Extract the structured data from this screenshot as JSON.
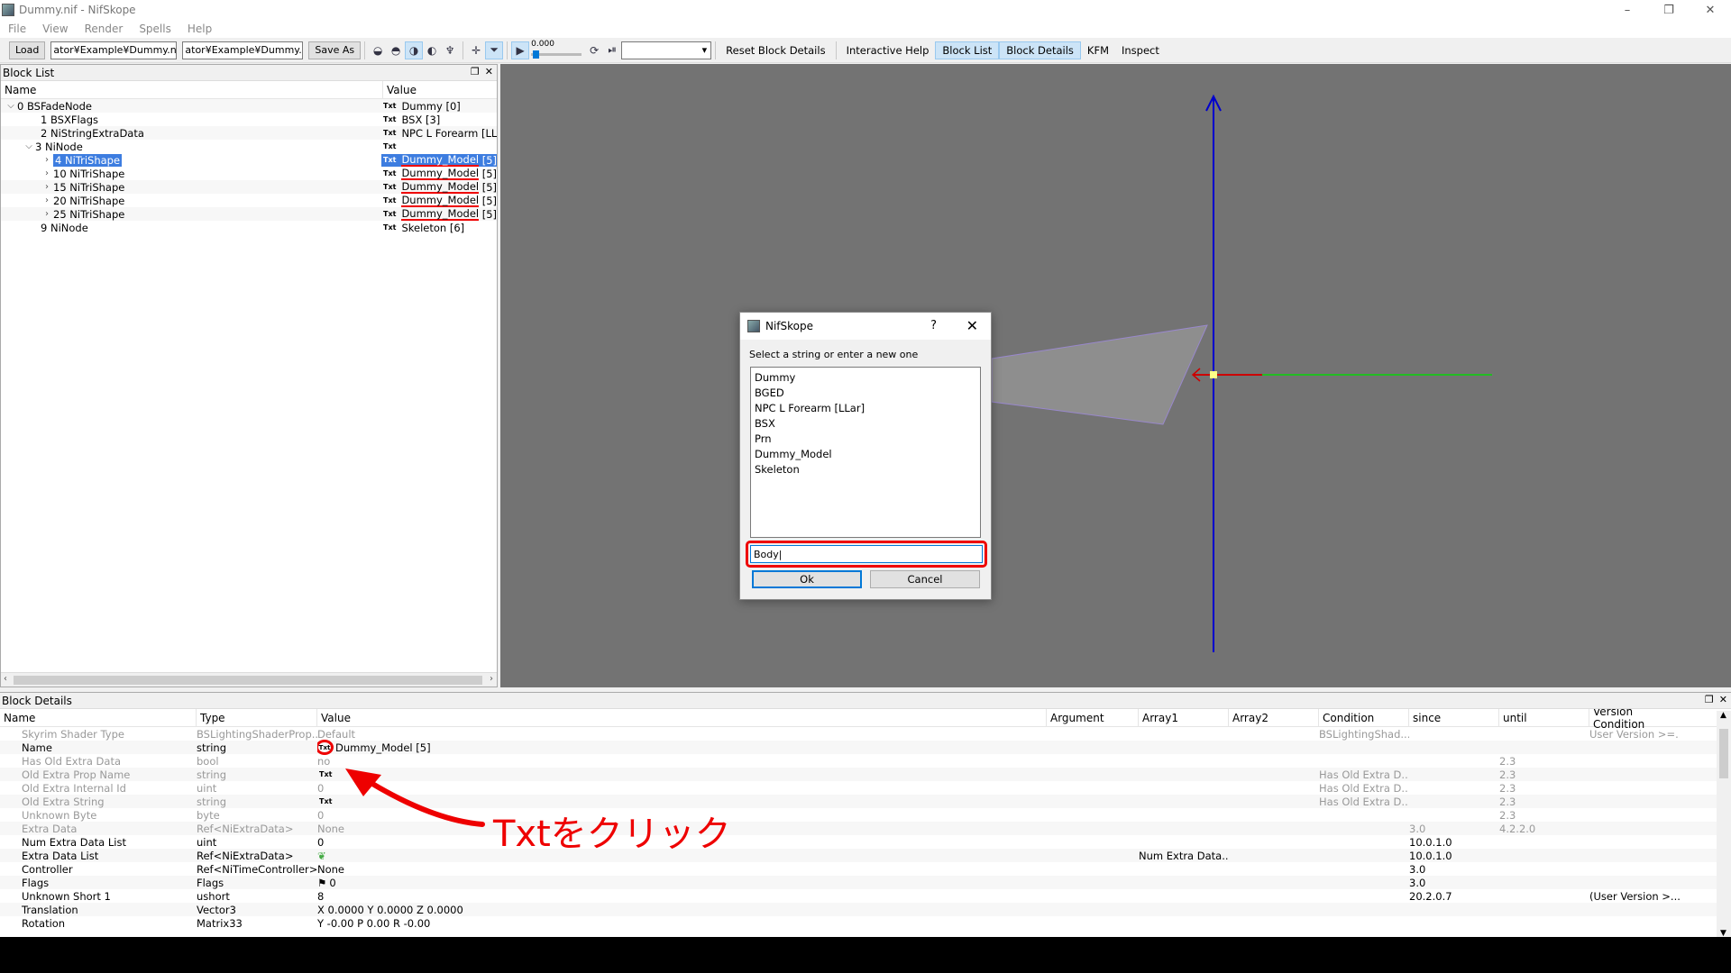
{
  "window": {
    "title": "Dummy.nif - NifSkope",
    "controls": [
      "–",
      "❐",
      "✕"
    ]
  },
  "menu": [
    "File",
    "View",
    "Render",
    "Spells",
    "Help"
  ],
  "toolbar": {
    "load_label": "Load",
    "path1": "ator¥Example¥Dummy.nif",
    "path2": "ator¥Example¥Dummy.nif",
    "save_as_label": "Save As",
    "time_value": "0.000",
    "reset_block_details": "Reset Block Details",
    "interactive_help": "Interactive Help",
    "block_list": "Block List",
    "block_details": "Block Details",
    "kfm": "KFM",
    "inspect": "Inspect"
  },
  "block_list": {
    "panel_title": "Block List",
    "col_name": "Name",
    "col_value": "Value",
    "txt_badge": "Txt",
    "rows": [
      {
        "name": "0 BSFadeNode",
        "value": "Dummy [0]"
      },
      {
        "name": "1 BSXFlags",
        "value": "BSX [3]"
      },
      {
        "name": "2 NiStringExtraData",
        "value": "NPC L Forearm [LLar"
      },
      {
        "name": "3 NiNode",
        "value": ""
      },
      {
        "name": "4 NiTriShape",
        "value_a": "Dummy_Model",
        "value_b": "[5]"
      },
      {
        "name": "10 NiTriShape",
        "value_a": "Dummy_Model",
        "value_b": "[5]"
      },
      {
        "name": "15 NiTriShape",
        "value_a": "Dummy_Model",
        "value_b": "[5]"
      },
      {
        "name": "20 NiTriShape",
        "value_a": "Dummy_Model",
        "value_b": "[5]"
      },
      {
        "name": "25 NiTriShape",
        "value_a": "Dummy_Model",
        "value_b": "[5]"
      },
      {
        "name": "9 NiNode",
        "value": "Skeleton [6]"
      }
    ]
  },
  "dialog": {
    "title": "NifSkope",
    "help": "?",
    "close": "✕",
    "prompt": "Select a string or enter a new one",
    "items": [
      "Dummy",
      "BGED",
      "NPC L Forearm [LLar]",
      "BSX",
      "Prn",
      "Dummy_Model",
      "Skeleton"
    ],
    "input_value": "Body|",
    "ok_label": "Ok",
    "cancel_label": "Cancel"
  },
  "block_details": {
    "panel_title": "Block Details",
    "columns": [
      "Name",
      "Type",
      "Value",
      "Argument",
      "Array1",
      "Array2",
      "Condition",
      "since",
      "until",
      "Version Condition"
    ],
    "rows": [
      {
        "name": "Skyrim Shader Type",
        "type": "BSLightingShaderProp...",
        "value": "Default",
        "arg": "",
        "a1": "",
        "a2": "",
        "cond": "BSLightingShad...",
        "since": "",
        "until": "",
        "vc": "User Version >=...",
        "dim": true
      },
      {
        "name": "Name",
        "type": "string",
        "value": "Dummy_Model [5]",
        "arg": "",
        "a1": "",
        "a2": "",
        "cond": "",
        "since": "",
        "until": "",
        "vc": "",
        "dim": false,
        "txt": "circle"
      },
      {
        "name": "Has Old Extra Data",
        "type": "bool",
        "value": "no",
        "arg": "",
        "a1": "",
        "a2": "",
        "cond": "",
        "since": "",
        "until": "2.3",
        "vc": "",
        "dim": true
      },
      {
        "name": "Old Extra Prop Name",
        "type": "string",
        "value": "",
        "arg": "",
        "a1": "",
        "a2": "",
        "cond": "Has Old Extra D...",
        "since": "",
        "until": "2.3",
        "vc": "",
        "dim": true,
        "txt": "plain"
      },
      {
        "name": "Old Extra Internal Id",
        "type": "uint",
        "value": "0",
        "arg": "",
        "a1": "",
        "a2": "",
        "cond": "Has Old Extra D...",
        "since": "",
        "until": "2.3",
        "vc": "",
        "dim": true
      },
      {
        "name": "Old Extra String",
        "type": "string",
        "value": "",
        "arg": "",
        "a1": "",
        "a2": "",
        "cond": "Has Old Extra D...",
        "since": "",
        "until": "2.3",
        "vc": "",
        "dim": true,
        "txt": "plain"
      },
      {
        "name": "Unknown Byte",
        "type": "byte",
        "value": "0",
        "arg": "",
        "a1": "",
        "a2": "",
        "cond": "",
        "since": "",
        "until": "2.3",
        "vc": "",
        "dim": true
      },
      {
        "name": "Extra Data",
        "type": "Ref<NiExtraData>",
        "value": "None",
        "arg": "",
        "a1": "",
        "a2": "",
        "cond": "",
        "since": "3.0",
        "until": "4.2.2.0",
        "vc": "",
        "dim": true
      },
      {
        "name": "Num Extra Data List",
        "type": "uint",
        "value": "0",
        "arg": "",
        "a1": "",
        "a2": "",
        "cond": "",
        "since": "10.0.1.0",
        "until": "",
        "vc": "",
        "dim": false
      },
      {
        "name": "Extra Data List",
        "type": "Ref<NiExtraData>",
        "value": "",
        "arg": "",
        "a1": "Num Extra Data...",
        "a2": "",
        "cond": "",
        "since": "10.0.1.0",
        "until": "",
        "vc": "",
        "dim": false,
        "icon": "leaf"
      },
      {
        "name": "Controller",
        "type": "Ref<NiTimeController>",
        "value": "None",
        "arg": "",
        "a1": "",
        "a2": "",
        "cond": "",
        "since": "3.0",
        "until": "",
        "vc": "",
        "dim": false
      },
      {
        "name": "Flags",
        "type": "Flags",
        "value": "0",
        "arg": "",
        "a1": "",
        "a2": "",
        "cond": "",
        "since": "3.0",
        "until": "",
        "vc": "",
        "dim": false,
        "icon": "flag"
      },
      {
        "name": "Unknown Short 1",
        "type": "ushort",
        "value": "8",
        "arg": "",
        "a1": "",
        "a2": "",
        "cond": "",
        "since": "20.2.0.7",
        "until": "",
        "vc": "(User Version >...",
        "dim": false
      },
      {
        "name": "Translation",
        "type": "Vector3",
        "value": "X 0.0000 Y 0.0000 Z 0.0000",
        "arg": "",
        "a1": "",
        "a2": "",
        "cond": "",
        "since": "",
        "until": "",
        "vc": "",
        "dim": false
      },
      {
        "name": "Rotation",
        "type": "Matrix33",
        "value": "Y -0.00 P 0.00 R -0.00",
        "arg": "",
        "a1": "",
        "a2": "",
        "cond": "",
        "since": "",
        "until": "",
        "vc": "",
        "dim": false
      }
    ]
  },
  "annotation": {
    "text": "Txtをクリック",
    "color": "#e00000"
  },
  "colors": {
    "selection": "#3d7de0",
    "axis_z": "#0000cc",
    "axis_x": "#cc0000",
    "axis_y": "#22bb22",
    "highlight": "#e00000"
  }
}
